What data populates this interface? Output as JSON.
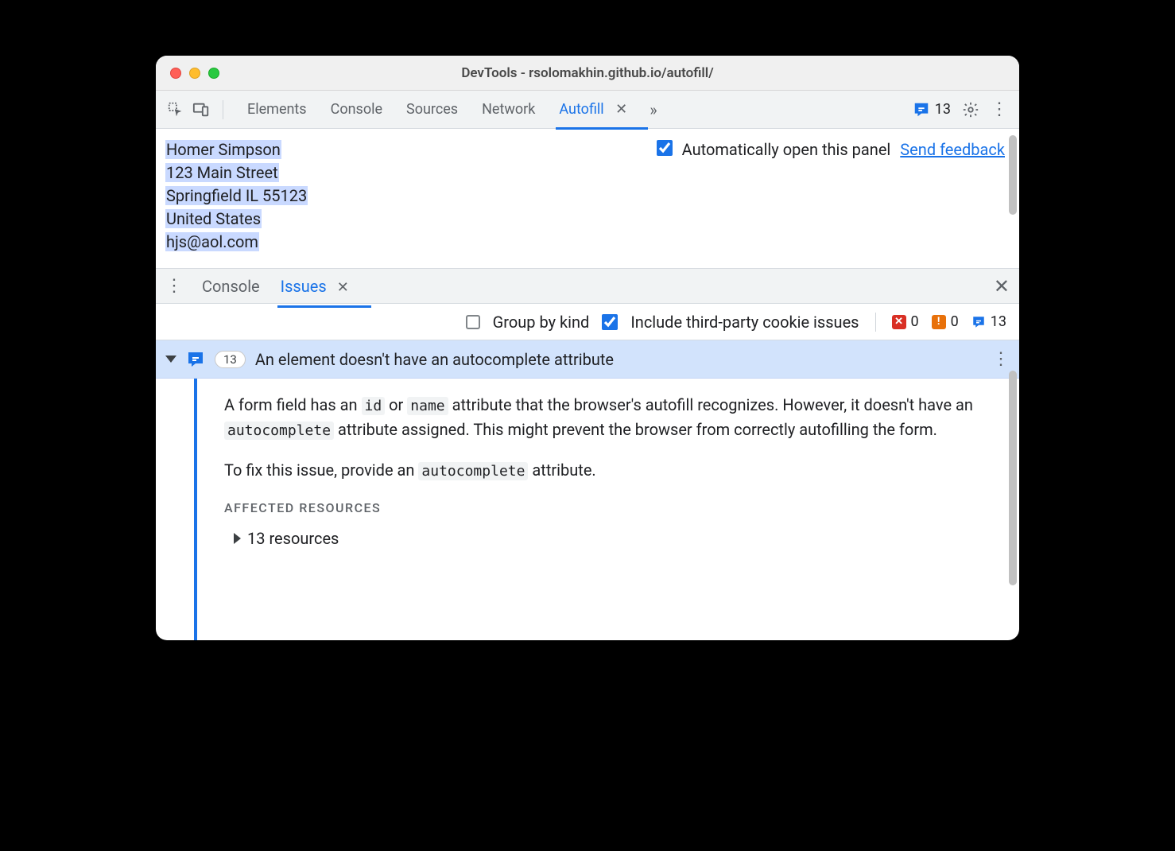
{
  "window": {
    "title": "DevTools - rsolomakhin.github.io/autofill/"
  },
  "toolbar": {
    "tabs": [
      {
        "label": "Elements",
        "active": false
      },
      {
        "label": "Console",
        "active": false
      },
      {
        "label": "Sources",
        "active": false
      },
      {
        "label": "Network",
        "active": false
      },
      {
        "label": "Autofill",
        "active": true
      }
    ],
    "issues_badge_count": "13"
  },
  "autofill": {
    "lines": [
      "Homer Simpson",
      "123 Main Street",
      "Springfield IL 55123",
      "United States",
      "hjs@aol.com"
    ],
    "auto_open_label": "Automatically open this panel",
    "auto_open_checked": true,
    "feedback_link": "Send feedback"
  },
  "drawer": {
    "tabs": [
      {
        "label": "Console",
        "active": false
      },
      {
        "label": "Issues",
        "active": true
      }
    ]
  },
  "filter": {
    "group_by_kind": {
      "label": "Group by kind",
      "checked": false
    },
    "include_third_party": {
      "label": "Include third-party cookie issues",
      "checked": true
    },
    "counts": {
      "errors": "0",
      "warnings": "0",
      "info": "13"
    }
  },
  "issue": {
    "count": "13",
    "title": "An element doesn't have an autocomplete attribute",
    "p1_a": "A form field has an ",
    "p1_code1": "id",
    "p1_b": " or ",
    "p1_code2": "name",
    "p1_c": " attribute that the browser's autofill recognizes. However, it doesn't have an ",
    "p1_code3": "autocomplete",
    "p1_d": " attribute assigned. This might prevent the browser from correctly autofilling the form.",
    "p2_a": "To fix this issue, provide an ",
    "p2_code1": "autocomplete",
    "p2_b": " attribute.",
    "affected_heading": "AFFECTED RESOURCES",
    "resources_label": "13 resources"
  }
}
